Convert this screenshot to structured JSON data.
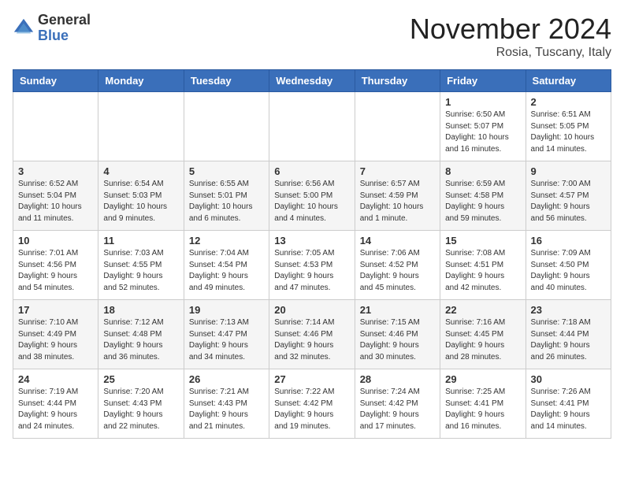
{
  "header": {
    "logo_general": "General",
    "logo_blue": "Blue",
    "month_title": "November 2024",
    "location": "Rosia, Tuscany, Italy"
  },
  "weekdays": [
    "Sunday",
    "Monday",
    "Tuesday",
    "Wednesday",
    "Thursday",
    "Friday",
    "Saturday"
  ],
  "weeks": [
    [
      {
        "day": "",
        "info": ""
      },
      {
        "day": "",
        "info": ""
      },
      {
        "day": "",
        "info": ""
      },
      {
        "day": "",
        "info": ""
      },
      {
        "day": "",
        "info": ""
      },
      {
        "day": "1",
        "info": "Sunrise: 6:50 AM\nSunset: 5:07 PM\nDaylight: 10 hours\nand 16 minutes."
      },
      {
        "day": "2",
        "info": "Sunrise: 6:51 AM\nSunset: 5:05 PM\nDaylight: 10 hours\nand 14 minutes."
      }
    ],
    [
      {
        "day": "3",
        "info": "Sunrise: 6:52 AM\nSunset: 5:04 PM\nDaylight: 10 hours\nand 11 minutes."
      },
      {
        "day": "4",
        "info": "Sunrise: 6:54 AM\nSunset: 5:03 PM\nDaylight: 10 hours\nand 9 minutes."
      },
      {
        "day": "5",
        "info": "Sunrise: 6:55 AM\nSunset: 5:01 PM\nDaylight: 10 hours\nand 6 minutes."
      },
      {
        "day": "6",
        "info": "Sunrise: 6:56 AM\nSunset: 5:00 PM\nDaylight: 10 hours\nand 4 minutes."
      },
      {
        "day": "7",
        "info": "Sunrise: 6:57 AM\nSunset: 4:59 PM\nDaylight: 10 hours\nand 1 minute."
      },
      {
        "day": "8",
        "info": "Sunrise: 6:59 AM\nSunset: 4:58 PM\nDaylight: 9 hours\nand 59 minutes."
      },
      {
        "day": "9",
        "info": "Sunrise: 7:00 AM\nSunset: 4:57 PM\nDaylight: 9 hours\nand 56 minutes."
      }
    ],
    [
      {
        "day": "10",
        "info": "Sunrise: 7:01 AM\nSunset: 4:56 PM\nDaylight: 9 hours\nand 54 minutes."
      },
      {
        "day": "11",
        "info": "Sunrise: 7:03 AM\nSunset: 4:55 PM\nDaylight: 9 hours\nand 52 minutes."
      },
      {
        "day": "12",
        "info": "Sunrise: 7:04 AM\nSunset: 4:54 PM\nDaylight: 9 hours\nand 49 minutes."
      },
      {
        "day": "13",
        "info": "Sunrise: 7:05 AM\nSunset: 4:53 PM\nDaylight: 9 hours\nand 47 minutes."
      },
      {
        "day": "14",
        "info": "Sunrise: 7:06 AM\nSunset: 4:52 PM\nDaylight: 9 hours\nand 45 minutes."
      },
      {
        "day": "15",
        "info": "Sunrise: 7:08 AM\nSunset: 4:51 PM\nDaylight: 9 hours\nand 42 minutes."
      },
      {
        "day": "16",
        "info": "Sunrise: 7:09 AM\nSunset: 4:50 PM\nDaylight: 9 hours\nand 40 minutes."
      }
    ],
    [
      {
        "day": "17",
        "info": "Sunrise: 7:10 AM\nSunset: 4:49 PM\nDaylight: 9 hours\nand 38 minutes."
      },
      {
        "day": "18",
        "info": "Sunrise: 7:12 AM\nSunset: 4:48 PM\nDaylight: 9 hours\nand 36 minutes."
      },
      {
        "day": "19",
        "info": "Sunrise: 7:13 AM\nSunset: 4:47 PM\nDaylight: 9 hours\nand 34 minutes."
      },
      {
        "day": "20",
        "info": "Sunrise: 7:14 AM\nSunset: 4:46 PM\nDaylight: 9 hours\nand 32 minutes."
      },
      {
        "day": "21",
        "info": "Sunrise: 7:15 AM\nSunset: 4:46 PM\nDaylight: 9 hours\nand 30 minutes."
      },
      {
        "day": "22",
        "info": "Sunrise: 7:16 AM\nSunset: 4:45 PM\nDaylight: 9 hours\nand 28 minutes."
      },
      {
        "day": "23",
        "info": "Sunrise: 7:18 AM\nSunset: 4:44 PM\nDaylight: 9 hours\nand 26 minutes."
      }
    ],
    [
      {
        "day": "24",
        "info": "Sunrise: 7:19 AM\nSunset: 4:44 PM\nDaylight: 9 hours\nand 24 minutes."
      },
      {
        "day": "25",
        "info": "Sunrise: 7:20 AM\nSunset: 4:43 PM\nDaylight: 9 hours\nand 22 minutes."
      },
      {
        "day": "26",
        "info": "Sunrise: 7:21 AM\nSunset: 4:43 PM\nDaylight: 9 hours\nand 21 minutes."
      },
      {
        "day": "27",
        "info": "Sunrise: 7:22 AM\nSunset: 4:42 PM\nDaylight: 9 hours\nand 19 minutes."
      },
      {
        "day": "28",
        "info": "Sunrise: 7:24 AM\nSunset: 4:42 PM\nDaylight: 9 hours\nand 17 minutes."
      },
      {
        "day": "29",
        "info": "Sunrise: 7:25 AM\nSunset: 4:41 PM\nDaylight: 9 hours\nand 16 minutes."
      },
      {
        "day": "30",
        "info": "Sunrise: 7:26 AM\nSunset: 4:41 PM\nDaylight: 9 hours\nand 14 minutes."
      }
    ]
  ]
}
